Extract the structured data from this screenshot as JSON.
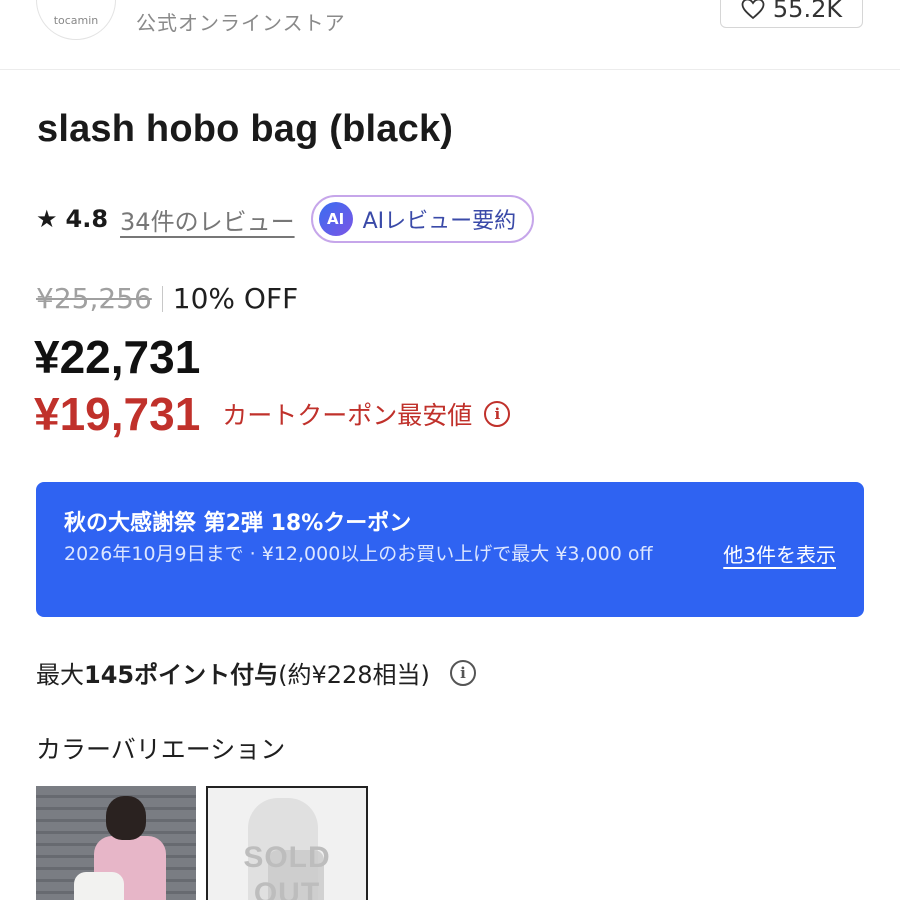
{
  "header": {
    "shop_logo_text": "tocamin",
    "store_subtitle": "公式オンラインストア",
    "favorite_count": "55.2K"
  },
  "product": {
    "title": "slash hobo bag (black)"
  },
  "rating": {
    "value": "4.8",
    "review_link": "34件のレビュー",
    "ai_badge": "AI",
    "ai_summary_label": "AIレビュー要約"
  },
  "pricing": {
    "original_price": "¥25,256",
    "discount": "10% OFF",
    "price": "¥22,731",
    "coupon_price": "¥19,731",
    "coupon_label": "カートクーポン最安値",
    "accent_color": "#c0312b"
  },
  "coupon_banner": {
    "title": "秋の大感謝祭 第2弾 18%クーポン",
    "description": "2026年10月9日まで · ¥12,000以上のお買い上げで最大 ¥3,000 off",
    "more_link": "他3件を表示",
    "background_color": "#2f63f2"
  },
  "points": {
    "prefix": "最大",
    "amount": "145ポイント付与",
    "suffix": "(約¥228相当)"
  },
  "variations": {
    "heading": "カラーバリエーション",
    "items": [
      {
        "color": "pink model with white bag",
        "sold_out": false
      },
      {
        "color": "black",
        "sold_out": true,
        "sold_out_label": "SOLD OUT"
      }
    ]
  },
  "icons": [
    "heart-icon",
    "star-icon",
    "info-icon"
  ]
}
